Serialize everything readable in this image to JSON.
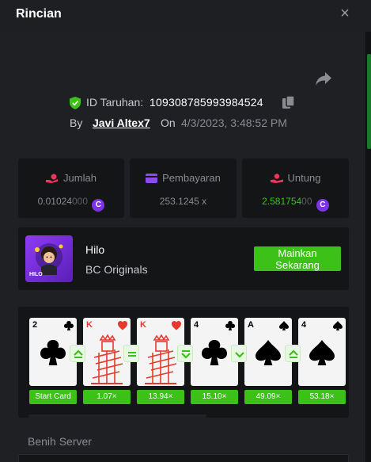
{
  "header": {
    "title": "Rincian",
    "close_icon": "×"
  },
  "bet": {
    "id_label": "ID Taruhan:",
    "id_value": "109308785993984524",
    "by_label": "By",
    "username": "Javi Altex7",
    "on_label": "On",
    "timestamp": "4/3/2023, 3:48:52 PM"
  },
  "stats": {
    "amount": {
      "label": "Jumlah",
      "value_main": "0.01024",
      "value_dim": "000",
      "coin": "C"
    },
    "payout": {
      "label": "Pembayaran",
      "value": "253.1245 x"
    },
    "profit": {
      "label": "Untung",
      "value_main": "2.581754",
      "value_dim": "00",
      "coin": "C"
    }
  },
  "game": {
    "name": "Hilo",
    "provider": "BC Originals",
    "thumb_label": "HILO",
    "play_label_line1": "Mainkan",
    "play_label_line2": "Sekarang"
  },
  "cards": [
    {
      "rank": "2",
      "suit": "club",
      "color": "#000000",
      "multiplier": "Start Card"
    },
    {
      "rank": "K",
      "suit": "heart",
      "color": "#e53a2c",
      "multiplier": "1.07×"
    },
    {
      "rank": "K",
      "suit": "heart",
      "color": "#e53a2c",
      "multiplier": "13.94×"
    },
    {
      "rank": "4",
      "suit": "club",
      "color": "#000000",
      "multiplier": "15.10×"
    },
    {
      "rank": "A",
      "suit": "spade",
      "color": "#000000",
      "multiplier": "49.09×"
    },
    {
      "rank": "4",
      "suit": "spade",
      "color": "#000000",
      "multiplier": "53.18×"
    }
  ],
  "guesses": [
    "higher-or-same",
    "same",
    "lower-or-same",
    "lower",
    "higher-or-same"
  ],
  "seed": {
    "label": "Benih Server"
  },
  "colors": {
    "accent_green": "#3bc117",
    "coin_purple": "#7d33e6",
    "background": "#1f2023",
    "panel": "#141517"
  }
}
